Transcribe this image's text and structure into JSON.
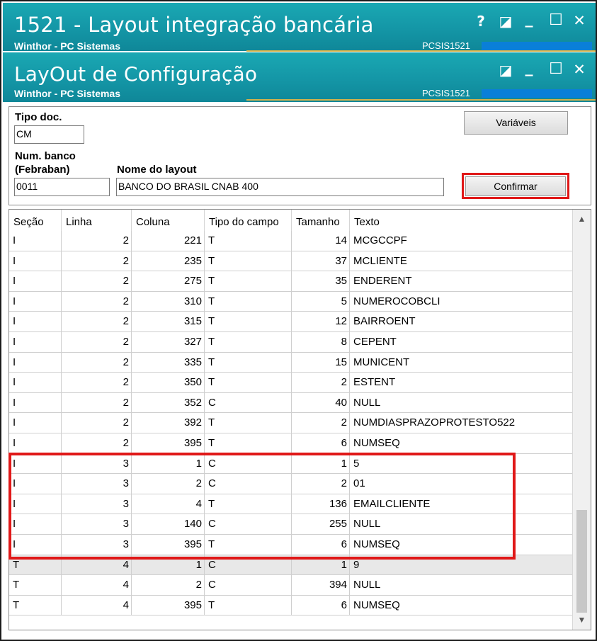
{
  "window1": {
    "title": "1521 - Layout integração bancária",
    "subtitle": "Winthor - PC Sistemas",
    "code": "PCSIS1521",
    "help_glyph": "?",
    "restore_glyph": "◪",
    "minimize_glyph": "_",
    "maximize_glyph": "☐",
    "close_glyph": "✕"
  },
  "window2": {
    "title": "LayOut de Configuração",
    "subtitle": "Winthor - PC Sistemas",
    "code": "PCSIS1521",
    "restore_glyph": "◪",
    "minimize_glyph": "_",
    "maximize_glyph": "☐",
    "close_glyph": "✕"
  },
  "form": {
    "tipo_doc_label": "Tipo doc.",
    "tipo_doc_value": "CM",
    "num_banco_label_line1": "Num. banco",
    "num_banco_label_line2": "(Febraban)",
    "num_banco_value": "0011",
    "nome_layout_label": "Nome do layout",
    "nome_layout_value": "BANCO DO BRASIL CNAB 400",
    "variaveis_button": "Variáveis",
    "confirmar_button": "Confirmar"
  },
  "table": {
    "headers": [
      "Seção",
      "Linha",
      "Coluna",
      "Tipo do campo",
      "Tamanho",
      "Texto"
    ],
    "rows": [
      {
        "secao": "I",
        "linha": "2",
        "coluna": "221",
        "tipo": "T",
        "tamanho": "14",
        "texto": "MCGCCPF"
      },
      {
        "secao": "I",
        "linha": "2",
        "coluna": "235",
        "tipo": "T",
        "tamanho": "37",
        "texto": "MCLIENTE"
      },
      {
        "secao": "I",
        "linha": "2",
        "coluna": "275",
        "tipo": "T",
        "tamanho": "35",
        "texto": "ENDERENT"
      },
      {
        "secao": "I",
        "linha": "2",
        "coluna": "310",
        "tipo": "T",
        "tamanho": "5",
        "texto": "NUMEROCOBCLI"
      },
      {
        "secao": "I",
        "linha": "2",
        "coluna": "315",
        "tipo": "T",
        "tamanho": "12",
        "texto": "BAIRROENT"
      },
      {
        "secao": "I",
        "linha": "2",
        "coluna": "327",
        "tipo": "T",
        "tamanho": "8",
        "texto": "CEPENT"
      },
      {
        "secao": "I",
        "linha": "2",
        "coluna": "335",
        "tipo": "T",
        "tamanho": "15",
        "texto": "MUNICENT"
      },
      {
        "secao": "I",
        "linha": "2",
        "coluna": "350",
        "tipo": "T",
        "tamanho": "2",
        "texto": "ESTENT"
      },
      {
        "secao": "I",
        "linha": "2",
        "coluna": "352",
        "tipo": "C",
        "tamanho": "40",
        "texto": "NULL"
      },
      {
        "secao": "I",
        "linha": "2",
        "coluna": "392",
        "tipo": "T",
        "tamanho": "2",
        "texto": "NUMDIASPRAZOPROTESTO522"
      },
      {
        "secao": "I",
        "linha": "2",
        "coluna": "395",
        "tipo": "T",
        "tamanho": "6",
        "texto": "NUMSEQ"
      },
      {
        "secao": "I",
        "linha": "3",
        "coluna": "1",
        "tipo": "C",
        "tamanho": "1",
        "texto": "5"
      },
      {
        "secao": "I",
        "linha": "3",
        "coluna": "2",
        "tipo": "C",
        "tamanho": "2",
        "texto": "01"
      },
      {
        "secao": "I",
        "linha": "3",
        "coluna": "4",
        "tipo": "T",
        "tamanho": "136",
        "texto": "EMAILCLIENTE"
      },
      {
        "secao": "I",
        "linha": "3",
        "coluna": "140",
        "tipo": "C",
        "tamanho": "255",
        "texto": "NULL"
      },
      {
        "secao": "I",
        "linha": "3",
        "coluna": "395",
        "tipo": "T",
        "tamanho": "6",
        "texto": "NUMSEQ"
      },
      {
        "secao": "T",
        "linha": "4",
        "coluna": "1",
        "tipo": "C",
        "tamanho": "1",
        "texto": "9"
      },
      {
        "secao": "T",
        "linha": "4",
        "coluna": "2",
        "tipo": "C",
        "tamanho": "394",
        "texto": "NULL"
      },
      {
        "secao": "T",
        "linha": "4",
        "coluna": "395",
        "tipo": "T",
        "tamanho": "6",
        "texto": "NUMSEQ"
      }
    ],
    "selected_row": 16
  },
  "scrollbar": {
    "up_glyph": "▲",
    "down_glyph": "▼",
    "position": 1.0
  },
  "colors": {
    "titlebar": "#1496a6",
    "accent_gold": "#d5b24a",
    "highlight_red": "#e01818"
  }
}
